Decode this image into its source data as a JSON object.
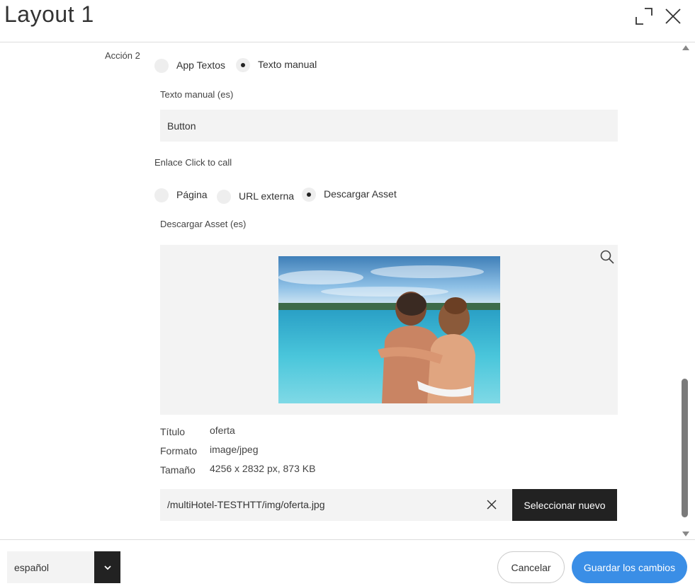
{
  "header": {
    "title": "Layout 1",
    "expand_icon": "expand-icon",
    "close_icon": "close-icon"
  },
  "action": {
    "label": "Acción 2",
    "source_options": [
      {
        "label": "App Textos",
        "checked": false
      },
      {
        "label": "Texto manual",
        "checked": true
      }
    ],
    "manual_text_label": "Texto manual (es)",
    "manual_text_value": "Button"
  },
  "link": {
    "label": "Enlace Click to call",
    "options": [
      {
        "label": "Página",
        "checked": false
      },
      {
        "label": "URL externa",
        "checked": false
      },
      {
        "label": "Descargar Asset",
        "checked": true
      }
    ],
    "asset_label": "Descargar Asset (es)"
  },
  "asset": {
    "zoom_icon": "search-icon",
    "meta": [
      {
        "key": "Título",
        "value": "oferta"
      },
      {
        "key": "Formato",
        "value": "image/jpeg"
      },
      {
        "key": "Tamaño",
        "value": "4256 x 2832 px, 873 KB"
      }
    ],
    "path": "/multiHotel-TESTHTT/img/oferta.jpg",
    "clear_icon": "close-icon",
    "select_new_label": "Seleccionar nuevo"
  },
  "footer": {
    "language": "español",
    "language_caret_icon": "chevron-down-icon",
    "cancel_label": "Cancelar",
    "save_label": "Guardar los cambios"
  },
  "colors": {
    "accent": "#3a8ee6",
    "dark": "#222222",
    "field_bg": "#f3f3f3"
  }
}
